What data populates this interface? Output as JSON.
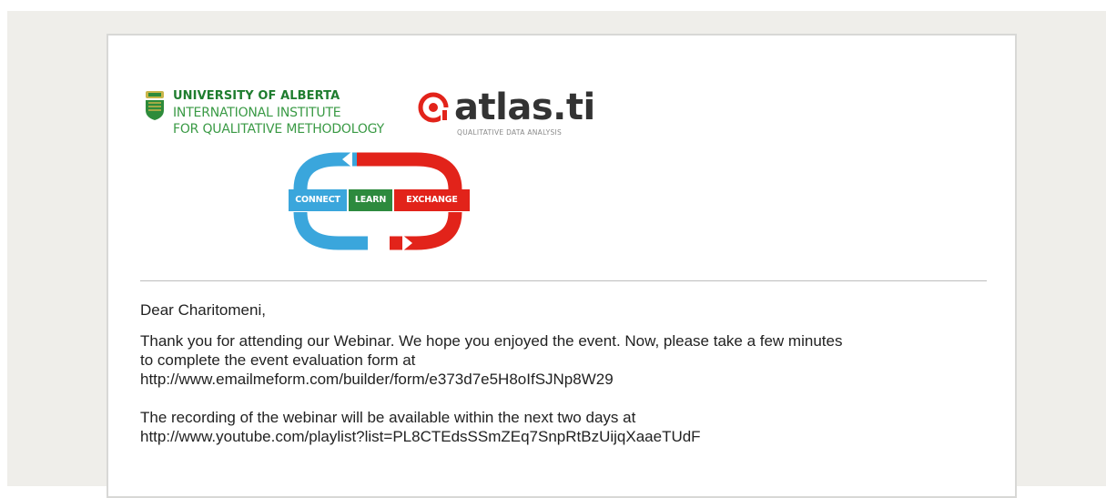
{
  "header": {
    "ua_logo": {
      "line1": "UNIVERSITY OF ALBERTA",
      "line2": "INTERNATIONAL INSTITUTE",
      "line3": "FOR QUALITATIVE METHODOLOGY",
      "crest_icon": "university-crest-icon",
      "color": "#2e8b3a"
    },
    "atlas_logo": {
      "wordmark": "atlas.ti",
      "tagline": "QUALITATIVE DATA ANALYSIS",
      "mark_icon": "atlas-ti-mark-icon",
      "color": "#e2231a"
    },
    "cle_logo": {
      "connect": "CONNECT",
      "learn": "LEARN",
      "exchange": "EXCHANGE",
      "colors": {
        "connect": "#3aa6dc",
        "learn": "#2d8a3e",
        "exchange": "#e2231a"
      }
    }
  },
  "email": {
    "greeting": "Dear Charitomeni,",
    "para1": {
      "line1": "Thank you for attending our Webinar. We hope you enjoyed the event. Now, please take a few minutes",
      "line2": "to complete the event evaluation form at",
      "link": "http://www.emailmeform.com/builder/form/e373d7e5H8oIfSJNp8W29"
    },
    "para2": {
      "line1": "The recording of the webinar will be available within the next two days at",
      "link": "http://www.youtube.com/playlist?list=PL8CTEdsSSmZEq7SnpRtBzUijqXaaeTUdF"
    }
  }
}
